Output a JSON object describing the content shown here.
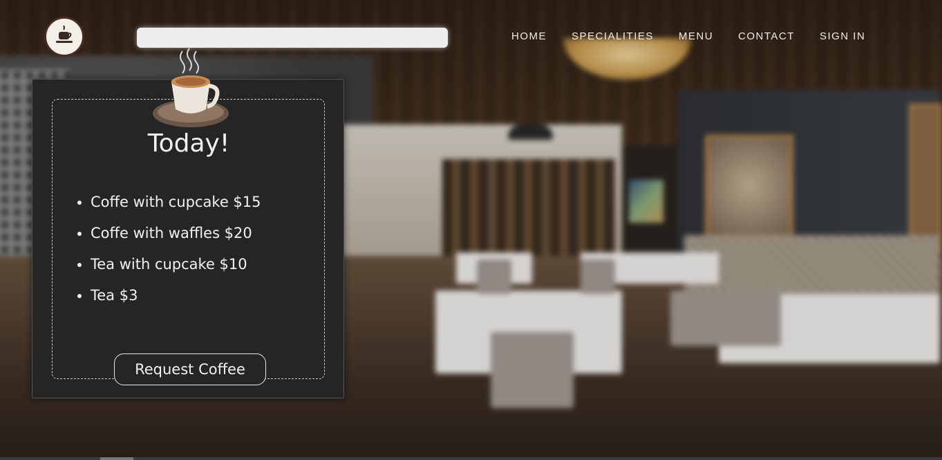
{
  "header": {
    "logo_icon": "coffee-cup-icon",
    "search": {
      "value": "",
      "placeholder": ""
    },
    "nav": [
      {
        "label": "HOME"
      },
      {
        "label": "SPECIALITIES"
      },
      {
        "label": "MENU"
      },
      {
        "label": "CONTACT"
      },
      {
        "label": "SIGN IN"
      }
    ]
  },
  "card": {
    "icon": "steaming-coffee-cup-icon",
    "title": "Today!",
    "items": [
      {
        "text": "Coffe with cupcake $15"
      },
      {
        "text": "Coffe with waffles $20"
      },
      {
        "text": "Tea with cupcake $10"
      },
      {
        "text": "Tea $3"
      }
    ],
    "button_label": "Request Coffee"
  },
  "colors": {
    "card_bg": "#252526",
    "logo_ring": "#4a2b24",
    "text_light": "#f5f2ee"
  }
}
